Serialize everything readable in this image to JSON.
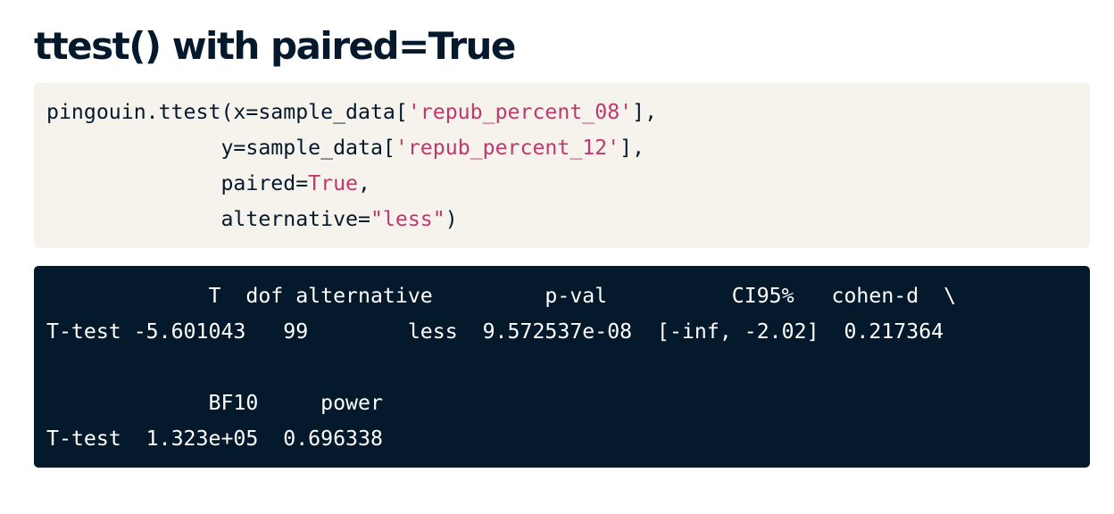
{
  "title": "ttest() with paired=True",
  "code": {
    "line1": {
      "prefix": "pingouin.ttest(x=sample_data[",
      "str": "'repub_percent_08'",
      "suffix": "],"
    },
    "line2": {
      "prefix": "              y=sample_data[",
      "str": "'repub_percent_12'",
      "suffix": "],"
    },
    "line3": {
      "prefix": "              paired=",
      "kw": "True",
      "suffix": ","
    },
    "line4": {
      "prefix": "              alternative=",
      "str": "\"less\"",
      "suffix": ")"
    }
  },
  "output": {
    "header1": "             T  dof alternative         p-val          CI95%   cohen-d  \\",
    "row1": "T-test -5.601043   99        less  9.572537e-08  [-inf, -2.02]  0.217364",
    "header2": "             BF10     power",
    "row2": "T-test  1.323e+05  0.696338"
  }
}
